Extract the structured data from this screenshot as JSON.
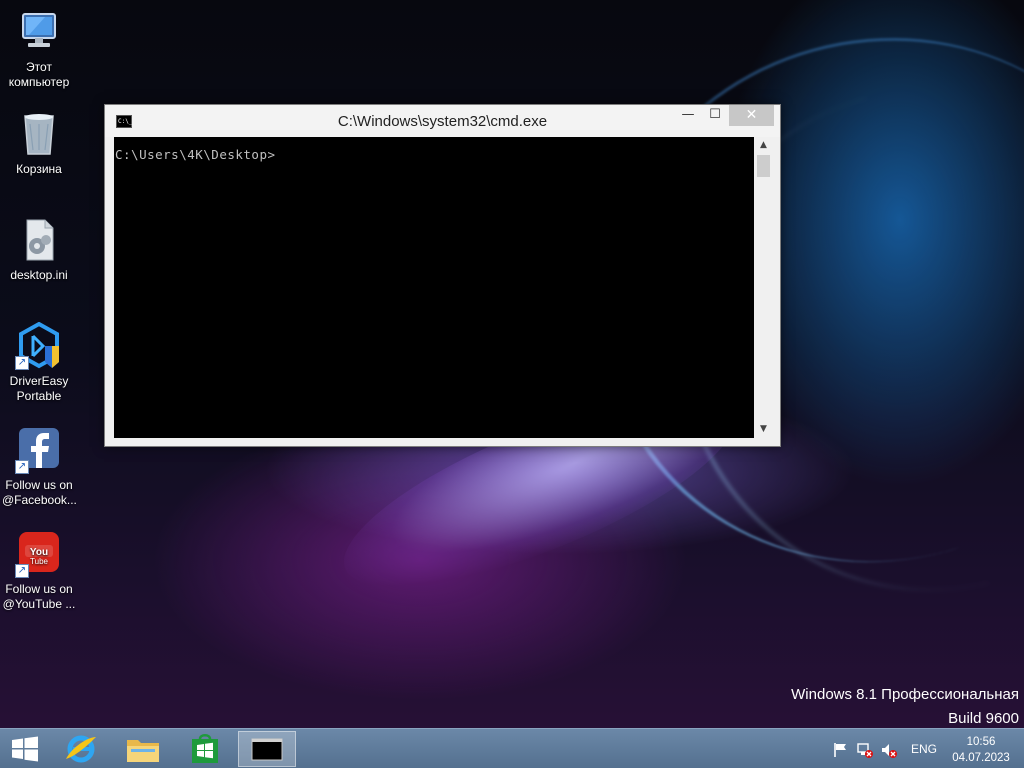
{
  "desktop": {
    "icons": [
      {
        "label": "Этот компьютер",
        "icon": "computer-icon"
      },
      {
        "label": "Корзина",
        "icon": "recycle-bin-icon"
      },
      {
        "label": "desktop.ini",
        "icon": "settings-file-icon"
      },
      {
        "label": "DriverEasy Portable",
        "icon": "drivereasy-icon"
      },
      {
        "label": "Follow us on @Facebook...",
        "icon": "facebook-icon"
      },
      {
        "label": "Follow us on @YouTube ...",
        "icon": "youtube-icon"
      }
    ],
    "watermark_line1": "Windows 8.1 Профессиональная",
    "watermark_line2": "Build 9600"
  },
  "cmd_window": {
    "title": "C:\\Windows\\system32\\cmd.exe",
    "icon_text": "C:\\_",
    "prompt": "C:\\Users\\4K\\Desktop>",
    "min_glyph": "—",
    "max_glyph": "☐",
    "close_glyph": "✕"
  },
  "taskbar": {
    "pinned": [
      "start-icon",
      "internet-explorer-icon",
      "file-explorer-icon",
      "store-icon",
      "cmd-icon"
    ],
    "active": "cmd-icon",
    "cmd_icon_text": "C:\\_",
    "language": "ENG",
    "time": "10:56",
    "date": "04.07.2023"
  },
  "colors": {
    "taskbar": "#5f7b9b",
    "console_bg": "#000000",
    "console_fg": "#c0c0c0",
    "close_button": "#c7c7c7"
  }
}
